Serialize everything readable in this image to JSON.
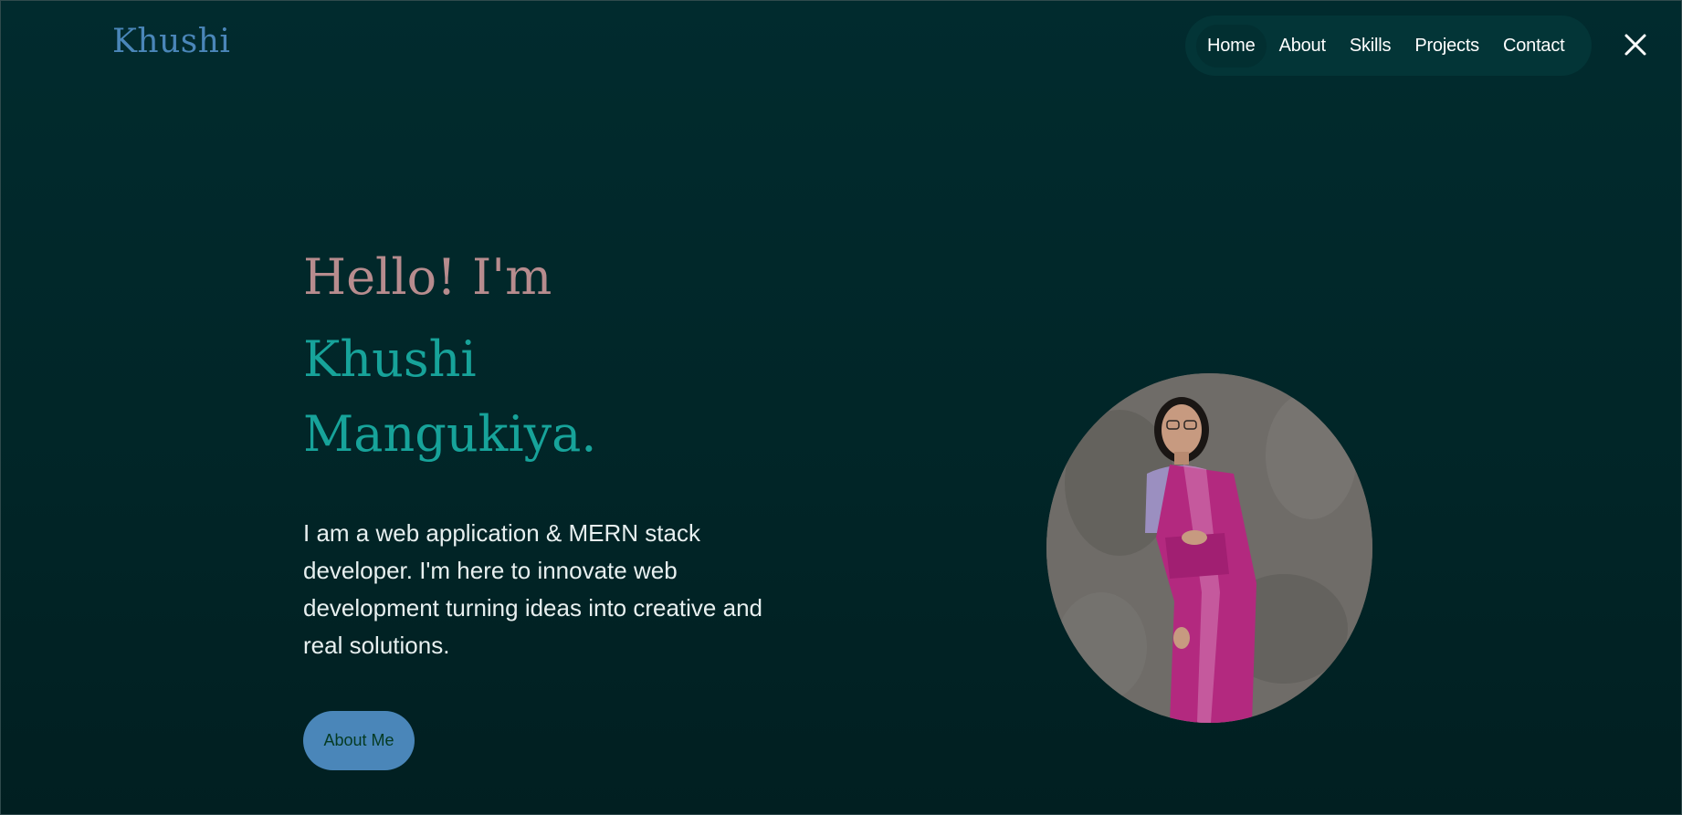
{
  "header": {
    "logo": "Khushi",
    "nav": [
      {
        "label": "Home",
        "active": true
      },
      {
        "label": "About",
        "active": false
      },
      {
        "label": "Skills",
        "active": false
      },
      {
        "label": "Projects",
        "active": false
      },
      {
        "label": "Contact",
        "active": false
      }
    ],
    "close_icon": "close-icon"
  },
  "hero": {
    "greeting": "Hello! I'm",
    "name_line1": "Khushi",
    "name_line2": "Mangukiya.",
    "description": "I am a web application & MERN stack developer. I'm here to innovate web development turning ideas into creative and real solutions.",
    "cta_label": "About Me"
  },
  "colors": {
    "background": "#012b2e",
    "logo": "#4a86b9",
    "greeting": "#b78c8e",
    "name": "#17a39a",
    "button": "#4a86b9"
  }
}
